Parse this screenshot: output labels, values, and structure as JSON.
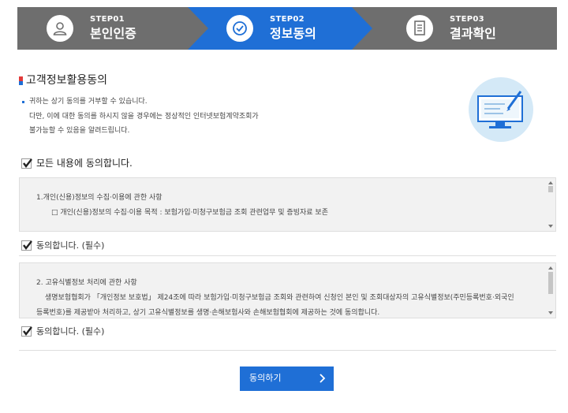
{
  "steps": [
    {
      "num": "STEP01",
      "label": "본인인증",
      "icon": "person-icon",
      "active": false
    },
    {
      "num": "STEP02",
      "label": "정보동의",
      "icon": "check-circle-icon",
      "active": true
    },
    {
      "num": "STEP03",
      "label": "결과확인",
      "icon": "document-icon",
      "active": false
    }
  ],
  "colors": {
    "active": "#1f6fd6",
    "inactive": "#6e6e6e",
    "box_bg": "#f2f2f2"
  },
  "section": {
    "title": "고객정보활용동의",
    "notice": [
      "귀하는 상기 동의를 거부할 수 있습니다.",
      "다만, 이에 대한 동의를 하시지 않을 경우에는 정상적인 인터넷보험계약조회가",
      "불가능할 수 있음을 알려드립니다."
    ]
  },
  "agree_all": {
    "label": "모든 내용에 동의합니다.",
    "checked": true
  },
  "agreements": [
    {
      "lines": [
        "1.개인(신용)정보의 수집·이용에 관한 사항",
        "□ 개인(신용)정보의 수집·이용 목적 : 보험가입·미청구보험금 조회 관련업무 및 증빙자료 보존"
      ],
      "consent_label": "동의합니다. (필수)",
      "checked": true
    },
    {
      "lines": [
        "2. 고유식별정보 처리에 관한 사항",
        "생명보험협회가 「개인정보 보호법」 제24조에 따라 보험가입·미청구보험금 조회와 관련하여 신청인 본인 및 조회대상자의 고유식별정보(주민등록번호·외국인",
        "등록번호)를 제공받아 처리하고, 상기 고유식별정보를 생명·손해보험사와 손해보험협회에 제공하는 것에 동의합니다."
      ],
      "consent_label": "동의합니다. (필수)",
      "checked": true
    }
  ],
  "submit": {
    "label": "동의하기",
    "icon": "chevron-right-icon"
  }
}
